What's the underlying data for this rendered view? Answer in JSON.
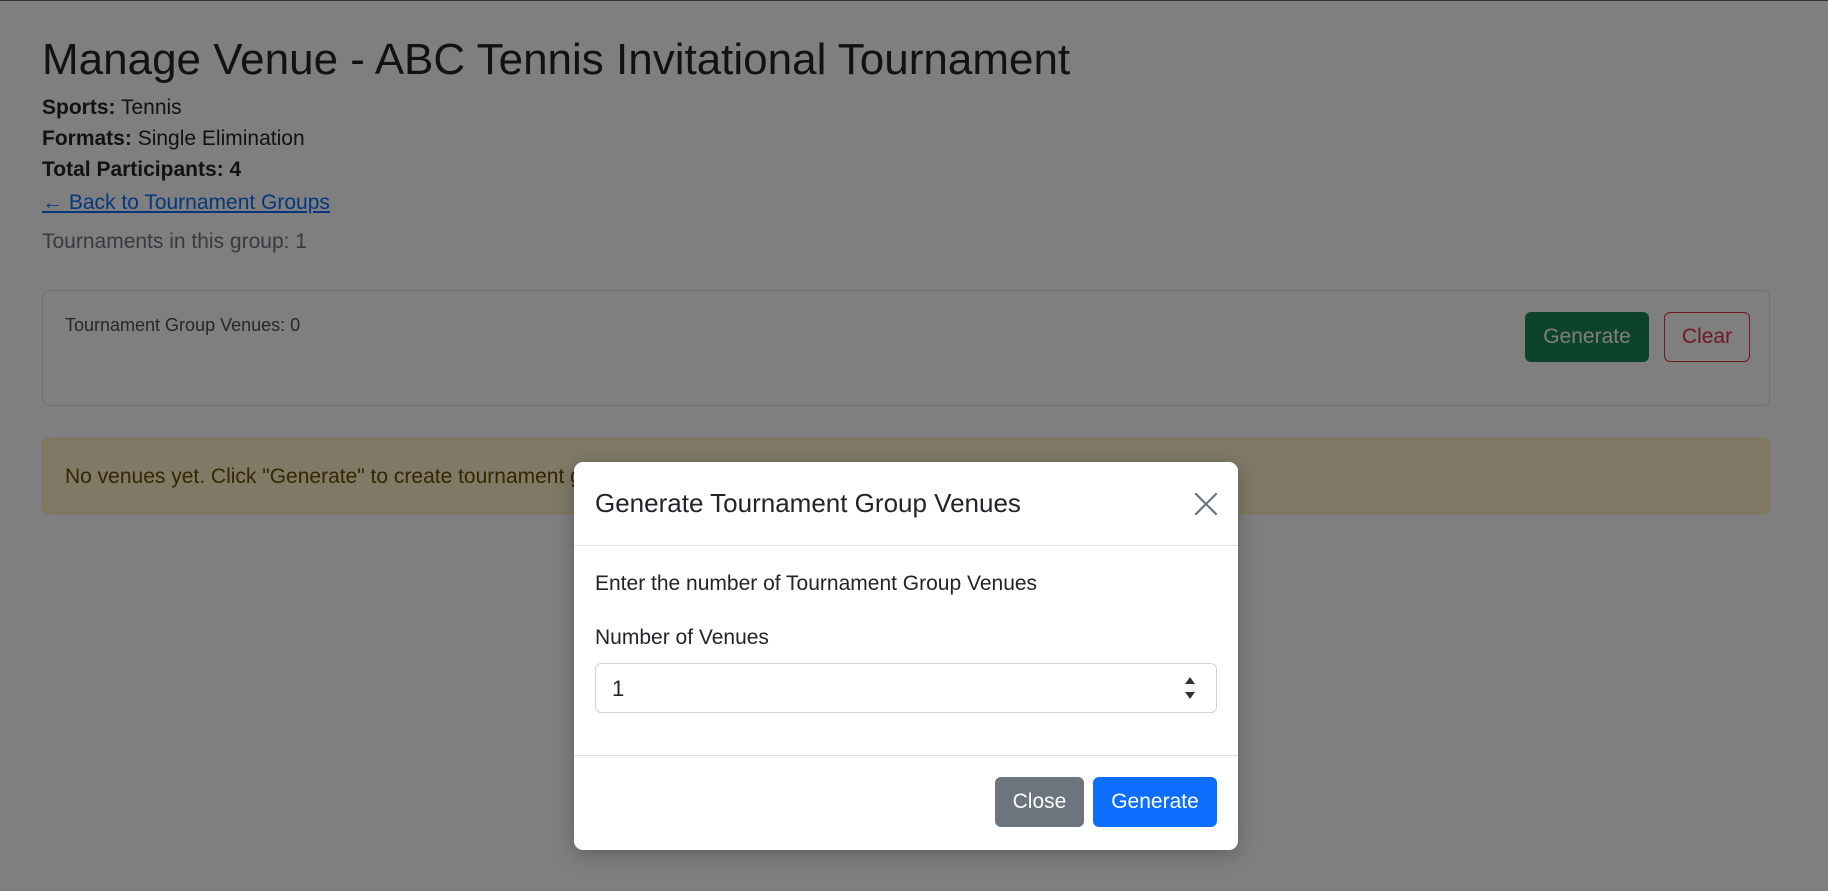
{
  "page": {
    "title": "Manage Venue - ABC Tennis Invitational Tournament",
    "sports_label": "Sports:",
    "sports_value": "Tennis",
    "formats_label": "Formats:",
    "formats_value": "Single Elimination",
    "participants_label": "Total Participants:",
    "participants_value": "4",
    "back_link": "← Back to Tournament Groups",
    "tournaments_count": "Tournaments in this group: 1"
  },
  "venues_card": {
    "label": "Tournament Group Venues: 0",
    "generate_label": "Generate",
    "clear_label": "Clear"
  },
  "alert": {
    "text": "No venues yet. Click \"Generate\" to create tournament group venues."
  },
  "modal": {
    "title": "Generate Tournament Group Venues",
    "close_icon": "close-icon",
    "description": "Enter the number of Tournament Group Venues",
    "field_label": "Number of Venues",
    "field_value": "1",
    "close_label": "Close",
    "generate_label": "Generate"
  },
  "colors": {
    "primary": "#0d6efd",
    "success": "#198754",
    "danger": "#dc3545",
    "secondary": "#6c757d",
    "warning_bg": "#fff3cd"
  }
}
